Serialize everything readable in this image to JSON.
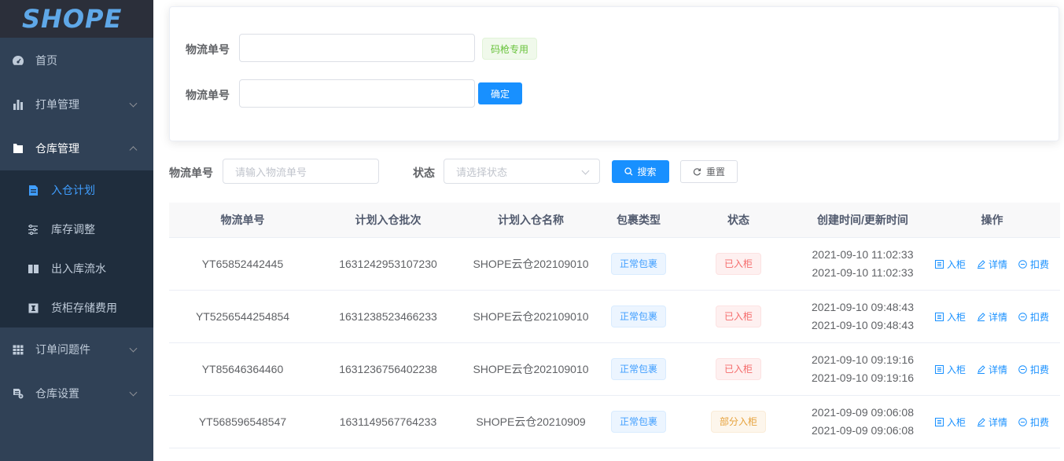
{
  "logo": {
    "text": "SHOPE"
  },
  "sidebar": {
    "items": [
      {
        "label": "首页",
        "icon": "dashboard-icon"
      },
      {
        "label": "打单管理",
        "icon": "bar-chart-icon"
      },
      {
        "label": "仓库管理",
        "icon": "folder-icon"
      },
      {
        "label": "订单问题件",
        "icon": "table-icon"
      },
      {
        "label": "仓库设置",
        "icon": "doc-settings-icon"
      }
    ],
    "sub_items": [
      {
        "label": "入仓计划",
        "icon": "document-icon",
        "active": true
      },
      {
        "label": "库存调整",
        "icon": "sliders-icon"
      },
      {
        "label": "出入库流水",
        "icon": "book-icon"
      },
      {
        "label": "货柜存储费用",
        "icon": "info-icon"
      }
    ]
  },
  "scan_form": {
    "label1": "物流单号",
    "label2": "物流单号",
    "input1_value": "",
    "input2_value": "",
    "scanner_tag": "码枪专用",
    "confirm_button": "确定"
  },
  "filter": {
    "tracking_label": "物流单号",
    "tracking_placeholder": "请输入物流单号",
    "status_label": "状态",
    "status_placeholder": "请选择状态",
    "search_button": "搜索",
    "reset_button": "重置"
  },
  "table": {
    "headers": [
      "物流单号",
      "计划入仓批次",
      "计划入仓名称",
      "包裹类型",
      "状态",
      "创建时间/更新时间",
      "操作"
    ],
    "actions": {
      "in_cabinet": "入柜",
      "details": "详情",
      "deduct": "扣费"
    },
    "rows": [
      {
        "tracking": "YT65852442445",
        "batch": "1631242953107230",
        "name": "SHOPE云仓202109010",
        "type": "正常包裹",
        "status": "已入柜",
        "status_color": "red",
        "created": "2021-09-10 11:02:33",
        "updated": "2021-09-10 11:02:33"
      },
      {
        "tracking": "YT5256544254854",
        "batch": "1631238523466233",
        "name": "SHOPE云仓202109010",
        "type": "正常包裹",
        "status": "已入柜",
        "status_color": "red",
        "created": "2021-09-10 09:48:43",
        "updated": "2021-09-10 09:48:43"
      },
      {
        "tracking": "YT85646364460",
        "batch": "1631236756402238",
        "name": "SHOPE云仓202109010",
        "type": "正常包裹",
        "status": "已入柜",
        "status_color": "red",
        "created": "2021-09-10 09:19:16",
        "updated": "2021-09-10 09:19:16"
      },
      {
        "tracking": "YT568596548547",
        "batch": "1631149567764233",
        "name": "SHOPE云仓20210909",
        "type": "正常包裹",
        "status": "部分入柜",
        "status_color": "orange",
        "created": "2021-09-09 09:06:08",
        "updated": "2021-09-09 09:06:08"
      }
    ]
  },
  "colors": {
    "sidebar_bg": "#304156",
    "submenu_bg": "#1f2d3d",
    "accent": "#1890ff",
    "active_text": "#409eff"
  }
}
